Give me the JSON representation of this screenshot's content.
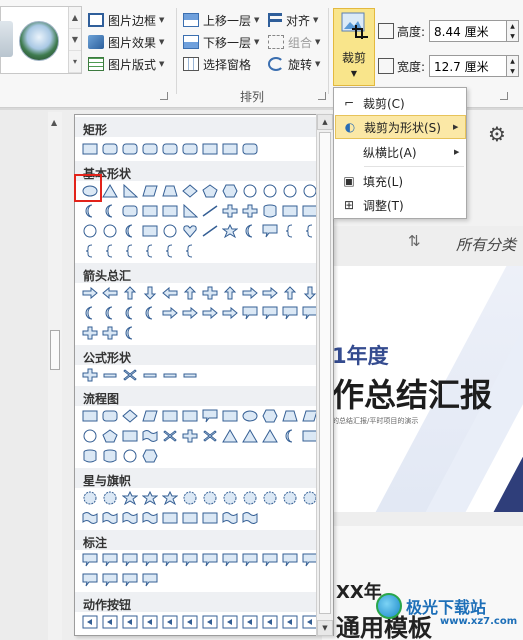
{
  "ribbon": {
    "picture_border": "图片边框",
    "picture_effect": "图片效果",
    "picture_layout": "图片版式",
    "bring_forward": "上移一层",
    "send_backward": "下移一层",
    "selection_pane": "选择窗格",
    "align": "对齐",
    "group": "组合",
    "rotate": "旋转",
    "arrange_group_label": "排列",
    "crop": "裁剪",
    "height_label": "高度:",
    "height_value": "8.44 厘米",
    "width_label": "宽度:",
    "width_value": "12.7 厘米"
  },
  "crop_menu": {
    "items": [
      {
        "label": "裁剪(C)",
        "icon": "crop-icon"
      },
      {
        "label": "裁剪为形状(S)",
        "icon": "crop-to-shape-icon",
        "has_submenu": true
      },
      {
        "label": "纵横比(A)",
        "icon": "",
        "has_submenu": true
      },
      {
        "label": "填充(L)",
        "icon": "fill-icon"
      },
      {
        "label": "调整(T)",
        "icon": "fit-icon"
      }
    ]
  },
  "shapes_gallery": {
    "categories": [
      "矩形",
      "基本形状",
      "箭头总汇",
      "公式形状",
      "流程图",
      "星与旗帜",
      "标注",
      "动作按钮"
    ]
  },
  "workspace": {
    "all_categories": "所有分类",
    "slide_year": "1年度",
    "slide_title": "作总结汇报",
    "slide_subtitle": "的总结汇报/平时项目的演示",
    "slide2_year": "XX年",
    "slide2_title": "通用模板"
  },
  "watermark": {
    "name": "极光下载站",
    "url": "www.xz7.com"
  },
  "colors": {
    "accent_yellow": "#f9e58b",
    "selection_red": "#e2231a",
    "slide_blue": "#344b8f"
  }
}
